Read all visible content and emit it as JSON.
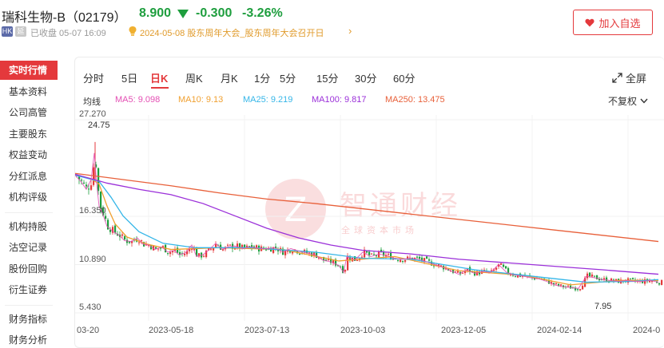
{
  "stock": {
    "name": "瑞科生物-B（02179）",
    "price": "8.900",
    "change": "-0.300",
    "change_pct": "-3.26%",
    "market_badge": "HK",
    "status_badge": "延",
    "closed_text": "已收盘 05-07 16:09",
    "notice": "2024-05-08 股东周年大会_股东周年大会召开日",
    "watch_label": "加入自选",
    "down_color": "#1e9e3e",
    "accent": "#e4393c"
  },
  "sidebar": {
    "groups": [
      [
        "实时行情",
        "基本资料",
        "公司高管",
        "主要股东",
        "权益变动",
        "分红派息",
        "机构评级"
      ],
      [
        "机构持股",
        "沽空记录",
        "股份回购",
        "衍生证券"
      ],
      [
        "财务指标",
        "财务分析"
      ]
    ]
  },
  "tabs": [
    "分时",
    "5日",
    "日K",
    "周K",
    "月K",
    "1分",
    "5分",
    "15分",
    "30分",
    "60分"
  ],
  "active_tab": "日K",
  "fullscreen_label": "全屏",
  "ma": {
    "label": "均线",
    "items": [
      {
        "text": "MA5:  9.098",
        "color": "#e44fb4"
      },
      {
        "text": "MA10:  9.13",
        "color": "#f0a030"
      },
      {
        "text": "MA25:  9.219",
        "color": "#35b6e8"
      },
      {
        "text": "MA100:  9.817",
        "color": "#9b30d9"
      },
      {
        "text": "MA250:  13.475",
        "color": "#e8603a"
      }
    ]
  },
  "adjust_label": "不复权",
  "chart_data": {
    "type": "candlestick",
    "y_ticks": [
      "27.270",
      "16.350",
      "10.890",
      "5.430"
    ],
    "x_ticks": [
      "03-20",
      "2023-05-18",
      "2023-07-13",
      "2023-10-03",
      "2023-12-05",
      "2024-02-14",
      "2024-0"
    ],
    "annotations": {
      "high": "24.75",
      "low": "7.95"
    },
    "ylim": [
      5.43,
      27.27
    ],
    "close_points": [
      [
        0,
        21.0
      ],
      [
        8,
        20.2
      ],
      [
        14,
        19.4
      ],
      [
        20,
        20.5
      ],
      [
        24,
        23.5
      ],
      [
        27,
        20.0
      ],
      [
        30,
        17.5
      ],
      [
        35,
        16.5
      ],
      [
        40,
        15.2
      ],
      [
        48,
        14.6
      ],
      [
        55,
        14.2
      ],
      [
        62,
        13.6
      ],
      [
        70,
        13.5
      ],
      [
        78,
        13.9
      ],
      [
        85,
        13.2
      ],
      [
        92,
        13.1
      ],
      [
        100,
        12.6
      ],
      [
        108,
        12.9
      ],
      [
        116,
        12.3
      ],
      [
        124,
        12.5
      ],
      [
        130,
        12.0
      ],
      [
        138,
        12.2
      ],
      [
        146,
        13.1
      ],
      [
        152,
        11.8
      ],
      [
        160,
        12.0
      ],
      [
        168,
        12.6
      ],
      [
        176,
        13.3
      ],
      [
        184,
        12.6
      ],
      [
        192,
        12.9
      ],
      [
        200,
        13.0
      ],
      [
        210,
        12.7
      ],
      [
        220,
        12.9
      ],
      [
        230,
        12.7
      ],
      [
        240,
        12.7
      ],
      [
        250,
        12.8
      ],
      [
        260,
        12.3
      ],
      [
        270,
        12.7
      ],
      [
        280,
        12.4
      ],
      [
        290,
        12.2
      ],
      [
        300,
        12.0
      ],
      [
        310,
        11.4
      ],
      [
        320,
        11.2
      ],
      [
        330,
        10.8
      ],
      [
        336,
        10.0
      ],
      [
        340,
        11.8
      ],
      [
        350,
        11.4
      ],
      [
        360,
        12.3
      ],
      [
        370,
        11.8
      ],
      [
        380,
        12.1
      ],
      [
        390,
        11.9
      ],
      [
        400,
        11.6
      ],
      [
        410,
        11.5
      ],
      [
        420,
        11.6
      ],
      [
        430,
        11.5
      ],
      [
        440,
        11.2
      ],
      [
        450,
        10.9
      ],
      [
        460,
        10.6
      ],
      [
        470,
        10.2
      ],
      [
        480,
        9.8
      ],
      [
        490,
        10.3
      ],
      [
        500,
        9.9
      ],
      [
        510,
        10.1
      ],
      [
        520,
        10.0
      ],
      [
        530,
        10.9
      ],
      [
        540,
        10.0
      ],
      [
        550,
        9.7
      ],
      [
        560,
        9.6
      ],
      [
        570,
        9.4
      ],
      [
        580,
        9.3
      ],
      [
        590,
        9.0
      ],
      [
        600,
        8.6
      ],
      [
        610,
        8.4
      ],
      [
        620,
        8.3
      ],
      [
        630,
        8.2
      ],
      [
        640,
        9.6
      ],
      [
        650,
        9.4
      ],
      [
        660,
        9.2
      ],
      [
        670,
        9.1
      ],
      [
        680,
        9.0
      ],
      [
        690,
        9.1
      ],
      [
        700,
        9.0
      ],
      [
        710,
        9.0
      ],
      [
        720,
        9.1
      ],
      [
        730,
        8.9
      ]
    ],
    "ma_series": {
      "MA10": [
        [
          0,
          21.0
        ],
        [
          20,
          20.6
        ],
        [
          30,
          20.0
        ],
        [
          40,
          17.5
        ],
        [
          50,
          15.5
        ],
        [
          65,
          14.0
        ],
        [
          90,
          13.2
        ],
        [
          120,
          12.6
        ],
        [
          180,
          12.8
        ],
        [
          260,
          12.6
        ],
        [
          330,
          11.3
        ],
        [
          400,
          11.8
        ],
        [
          480,
          10.2
        ],
        [
          560,
          9.7
        ],
        [
          620,
          8.6
        ],
        [
          680,
          9.1
        ],
        [
          730,
          9.1
        ]
      ],
      "MA25": [
        [
          0,
          21.0
        ],
        [
          30,
          20.3
        ],
        [
          45,
          18.5
        ],
        [
          60,
          16.4
        ],
        [
          80,
          14.6
        ],
        [
          110,
          13.3
        ],
        [
          150,
          12.8
        ],
        [
          220,
          12.8
        ],
        [
          300,
          12.3
        ],
        [
          360,
          11.6
        ],
        [
          420,
          11.5
        ],
        [
          500,
          10.3
        ],
        [
          570,
          9.6
        ],
        [
          640,
          8.9
        ],
        [
          700,
          9.0
        ],
        [
          730,
          9.2
        ]
      ],
      "MA100": [
        [
          0,
          21.1
        ],
        [
          40,
          20.1
        ],
        [
          80,
          19.4
        ],
        [
          120,
          18.8
        ],
        [
          160,
          17.8
        ],
        [
          200,
          16.4
        ],
        [
          240,
          15.0
        ],
        [
          280,
          13.9
        ],
        [
          320,
          13.1
        ],
        [
          360,
          12.5
        ],
        [
          420,
          12.1
        ],
        [
          480,
          11.5
        ],
        [
          540,
          11.1
        ],
        [
          600,
          10.7
        ],
        [
          660,
          10.3
        ],
        [
          730,
          9.8
        ]
      ],
      "MA250": [
        [
          0,
          21.2
        ],
        [
          60,
          20.5
        ],
        [
          120,
          19.8
        ],
        [
          180,
          19.0
        ],
        [
          240,
          18.3
        ],
        [
          300,
          17.8
        ],
        [
          360,
          17.2
        ],
        [
          420,
          16.6
        ],
        [
          480,
          16.0
        ],
        [
          540,
          15.4
        ],
        [
          600,
          14.8
        ],
        [
          660,
          14.2
        ],
        [
          730,
          13.5
        ]
      ]
    },
    "ma5_color": "#e44fb4",
    "up_color": "#e4393c",
    "down_color": "#1e9e3e"
  },
  "watermark": {
    "title": "智通财经",
    "subtitle": "全球资本市场"
  }
}
